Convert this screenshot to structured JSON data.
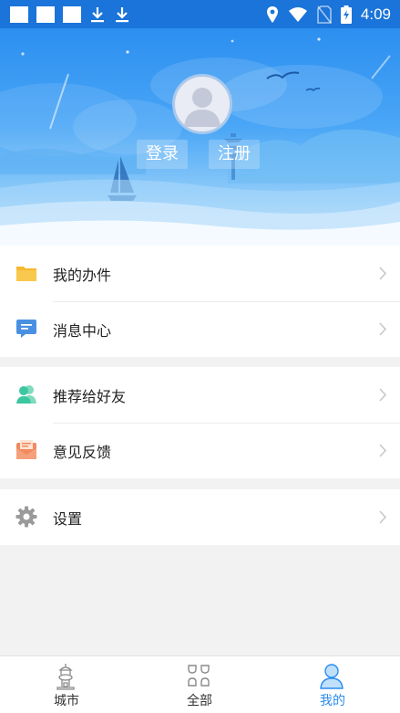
{
  "status_bar": {
    "time": "4:09",
    "icons": [
      "notification-square",
      "notification-square",
      "notification-square",
      "download-icon",
      "download-icon",
      "location-icon",
      "wifi-icon",
      "no-sim-icon",
      "battery-charging-icon"
    ]
  },
  "header": {
    "avatar_icon": "default-user-avatar",
    "login_label": "登录",
    "register_label": "注册"
  },
  "menu": {
    "groups": [
      [
        {
          "label": "我的办件",
          "icon": "folder-icon",
          "color": "#f5b82e"
        },
        {
          "label": "消息中心",
          "icon": "message-icon",
          "color": "#4a90e2"
        }
      ],
      [
        {
          "label": "推荐给好友",
          "icon": "users-icon",
          "color": "#3cc7a0"
        },
        {
          "label": "意见反馈",
          "icon": "feedback-mail-icon",
          "color": "#f08a5d"
        }
      ],
      [
        {
          "label": "设置",
          "icon": "gear-icon",
          "color": "#9a9a9a"
        }
      ]
    ]
  },
  "tabbar": {
    "tabs": [
      {
        "label": "城市",
        "icon": "city-landmark-icon"
      },
      {
        "label": "全部",
        "icon": "grid-all-icon"
      },
      {
        "label": "我的",
        "icon": "profile-icon",
        "active": true
      }
    ]
  },
  "colors": {
    "status_bar": "#1a74d9",
    "accent": "#2a8cf0",
    "background": "#f2f2f2"
  }
}
